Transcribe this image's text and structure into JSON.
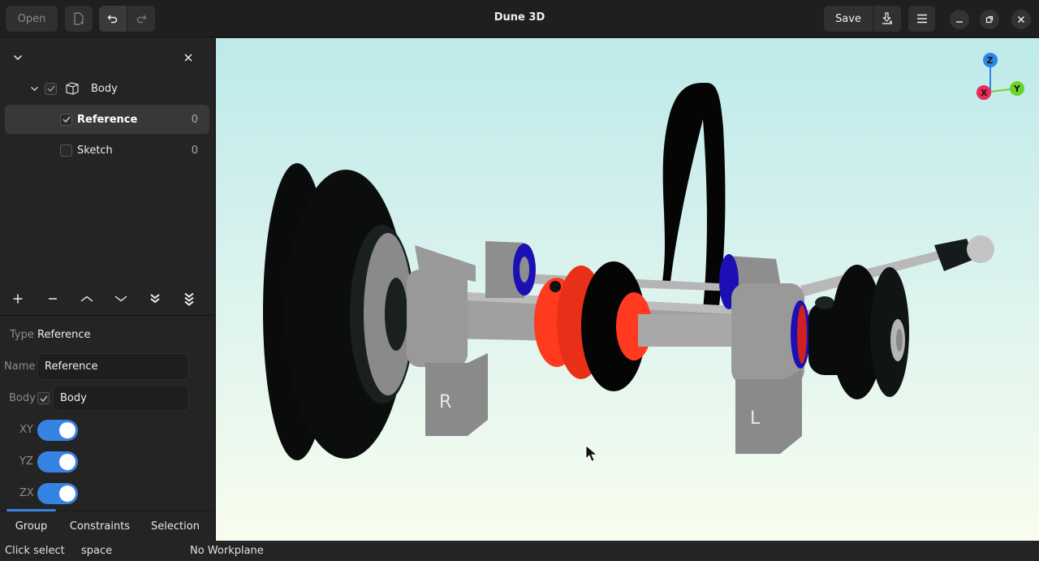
{
  "header": {
    "title": "Dune 3D",
    "open_label": "Open",
    "new_doc_icon": "new-document-icon",
    "undo_icon": "undo-icon",
    "redo_icon": "redo-icon",
    "save_label": "Save",
    "export_icon": "export-download-icon",
    "menu_icon": "hamburger-menu-icon",
    "window_controls": [
      "minimize",
      "maximize",
      "close"
    ]
  },
  "tree": {
    "collapse_icon": "chevron-down-icon",
    "close_icon": "close-icon",
    "body": {
      "label": "Body",
      "checked": true,
      "expanded": true
    },
    "groups": [
      {
        "label": "Reference",
        "checked": true,
        "selected": true,
        "count": "0"
      },
      {
        "label": "Sketch",
        "checked": false,
        "selected": false,
        "count": "0"
      }
    ]
  },
  "group_toolbar": {
    "buttons": [
      "add",
      "remove",
      "move-up",
      "move-down",
      "move-to-end",
      "move-to-bottom"
    ]
  },
  "properties": {
    "type_label": "Type",
    "type_value": "Reference",
    "name_label": "Name",
    "name_value": "Reference",
    "body_label": "Body",
    "body_checked": true,
    "body_value": "Body",
    "planes": [
      {
        "label": "XY",
        "enabled": true
      },
      {
        "label": "YZ",
        "enabled": true
      },
      {
        "label": "ZX",
        "enabled": true
      }
    ]
  },
  "tabs": [
    {
      "label": "Group",
      "active": true
    },
    {
      "label": "Constraints",
      "active": false
    },
    {
      "label": "Selection",
      "active": false
    }
  ],
  "statusbar": {
    "action": "Click select",
    "key": "space",
    "workplane": "No Workplane"
  },
  "viewport": {
    "part_labels": [
      "R",
      "L"
    ],
    "axes": {
      "x": "X",
      "y": "Y",
      "z": "Z"
    },
    "colors": {
      "axis_x": "#ee2a5a",
      "axis_y": "#6cd32a",
      "axis_z": "#2f86e8",
      "bracket": "#8c8c8c",
      "coupler": "#ff3a1f",
      "bearing": "#1c10b4",
      "belt": "#050505"
    }
  }
}
